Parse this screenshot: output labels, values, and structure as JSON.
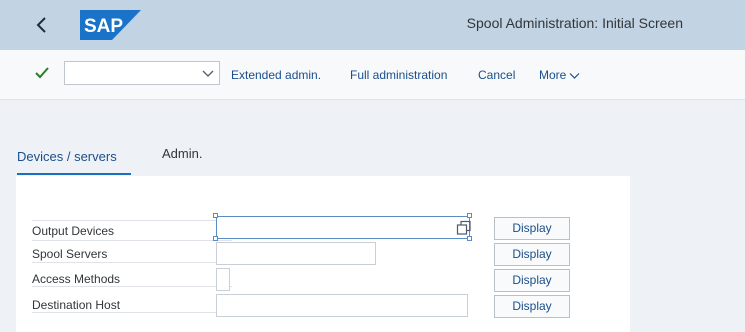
{
  "shell": {
    "logo_text": "SAP",
    "title": "Spool Administration: Initial Screen",
    "header_color": "#c2d3e4",
    "logo_color": "#1a73c8"
  },
  "toolbar": {
    "command_field": {
      "value": "",
      "placeholder": ""
    },
    "buttons": [
      {
        "label": "Extended admin."
      },
      {
        "label": "Full administration"
      },
      {
        "label": "Cancel"
      },
      {
        "label": "More"
      }
    ]
  },
  "tabs": [
    {
      "label": "Devices / servers",
      "active": true
    },
    {
      "label": "Admin.",
      "active": false
    }
  ],
  "form": {
    "rows": [
      {
        "label": "Output Devices",
        "value": "",
        "button": "Display"
      },
      {
        "label": "Spool Servers",
        "value": "",
        "button": "Display"
      },
      {
        "label": "Access Methods",
        "value": "",
        "button": "Display"
      },
      {
        "label": "Destination Host",
        "value": "",
        "button": "Display"
      }
    ]
  }
}
